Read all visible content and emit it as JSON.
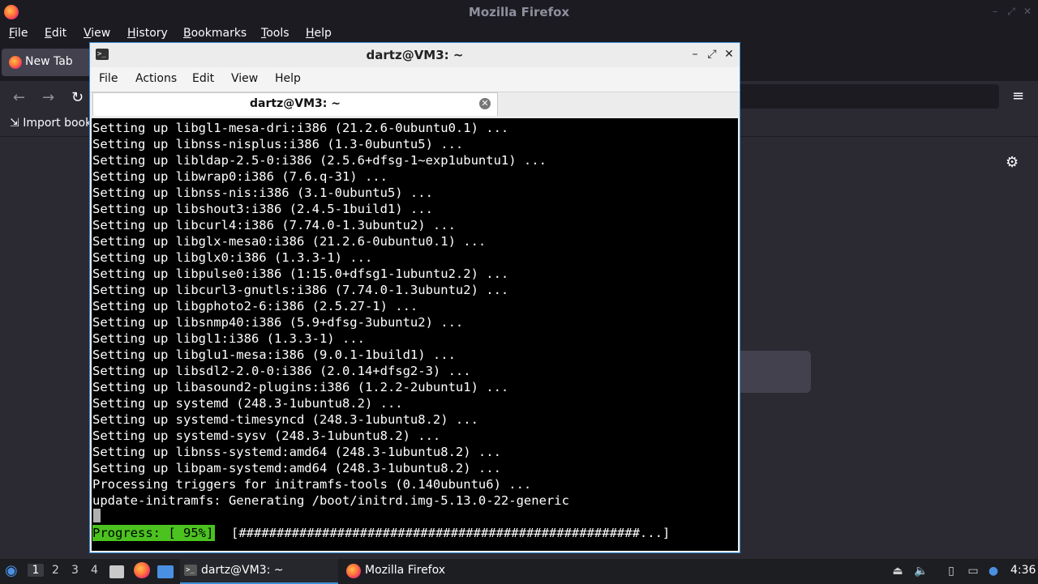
{
  "firefox": {
    "window_title": "Mozilla Firefox",
    "menu": [
      "File",
      "Edit",
      "View",
      "History",
      "Bookmarks",
      "Tools",
      "Help"
    ],
    "tab_label": "New Tab",
    "bookmarks_import": "Import book"
  },
  "terminal": {
    "window_title": "dartz@VM3: ~",
    "menu": [
      "File",
      "Actions",
      "Edit",
      "View",
      "Help"
    ],
    "tab_label": "dartz@VM3: ~",
    "lines": [
      "Setting up libgl1-mesa-dri:i386 (21.2.6-0ubuntu0.1) ...",
      "Setting up libnss-nisplus:i386 (1.3-0ubuntu5) ...",
      "Setting up libldap-2.5-0:i386 (2.5.6+dfsg-1~exp1ubuntu1) ...",
      "Setting up libwrap0:i386 (7.6.q-31) ...",
      "Setting up libnss-nis:i386 (3.1-0ubuntu5) ...",
      "Setting up libshout3:i386 (2.4.5-1build1) ...",
      "Setting up libcurl4:i386 (7.74.0-1.3ubuntu2) ...",
      "Setting up libglx-mesa0:i386 (21.2.6-0ubuntu0.1) ...",
      "Setting up libglx0:i386 (1.3.3-1) ...",
      "Setting up libpulse0:i386 (1:15.0+dfsg1-1ubuntu2.2) ...",
      "Setting up libcurl3-gnutls:i386 (7.74.0-1.3ubuntu2) ...",
      "Setting up libgphoto2-6:i386 (2.5.27-1) ...",
      "Setting up libsnmp40:i386 (5.9+dfsg-3ubuntu2) ...",
      "Setting up libgl1:i386 (1.3.3-1) ...",
      "Setting up libglu1-mesa:i386 (9.0.1-1build1) ...",
      "Setting up libsdl2-2.0-0:i386 (2.0.14+dfsg2-3) ...",
      "Setting up libasound2-plugins:i386 (1.2.2-2ubuntu1) ...",
      "Setting up systemd (248.3-1ubuntu8.2) ...",
      "Setting up systemd-timesyncd (248.3-1ubuntu8.2) ...",
      "Setting up systemd-sysv (248.3-1ubuntu8.2) ...",
      "Setting up libnss-systemd:amd64 (248.3-1ubuntu8.2) ...",
      "Setting up libpam-systemd:amd64 (248.3-1ubuntu8.2) ...",
      "Processing triggers for initramfs-tools (0.140ubuntu6) ...",
      "update-initramfs: Generating /boot/initrd.img-5.13.0-22-generic"
    ],
    "progress_label": "Progress: [ 95%]",
    "progress_bar": "[#####################################################...]",
    "progress_percent": 95
  },
  "taskbar": {
    "workspaces": [
      "1",
      "2",
      "3",
      "4"
    ],
    "tasks": [
      {
        "label": "dartz@VM3: ~",
        "icon": "terminal-icon"
      },
      {
        "label": "Mozilla Firefox",
        "icon": "firefox-icon"
      }
    ],
    "clock": "4:36"
  }
}
